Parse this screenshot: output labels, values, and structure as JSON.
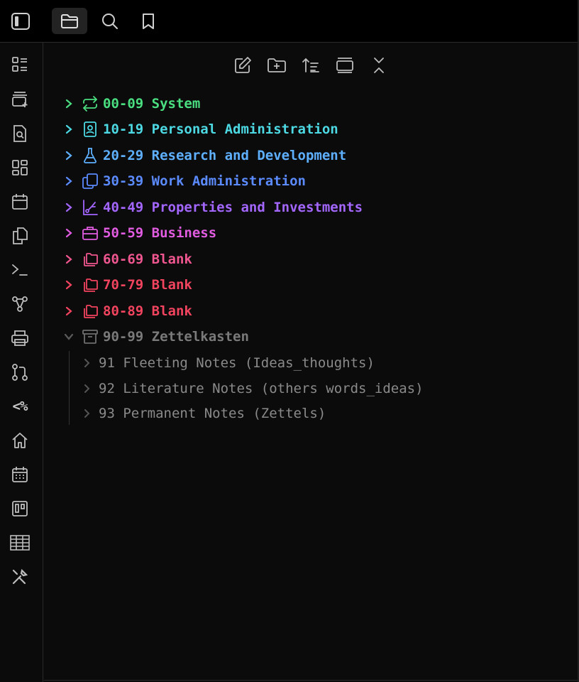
{
  "titlebar": {
    "buttons": [
      {
        "name": "toggle-sidebar-button",
        "icon": "sidebar-panel-icon"
      },
      {
        "name": "file-explorer-tab",
        "icon": "folder-open-icon",
        "active": true
      },
      {
        "name": "search-tab",
        "icon": "search-icon"
      },
      {
        "name": "bookmarks-tab",
        "icon": "bookmark-icon"
      }
    ]
  },
  "ribbon": {
    "items": [
      {
        "icon": "dashboard-list-icon"
      },
      {
        "icon": "new-canvas-icon"
      },
      {
        "icon": "file-search-icon"
      },
      {
        "icon": "layout-grid-icon"
      },
      {
        "icon": "calendar-icon"
      },
      {
        "icon": "copy-files-icon"
      },
      {
        "icon": "terminal-icon"
      },
      {
        "icon": "graph-view-icon"
      },
      {
        "icon": "print-icon"
      },
      {
        "icon": "git-pull-request-icon"
      },
      {
        "icon": "templater-icon",
        "text": "<%"
      },
      {
        "icon": "home-icon"
      },
      {
        "icon": "calendar-days-icon"
      },
      {
        "icon": "kanban-icon"
      },
      {
        "icon": "table-icon"
      },
      {
        "icon": "tools-icon"
      }
    ]
  },
  "explorer_actions": [
    {
      "name": "new-note-button",
      "icon": "edit-icon"
    },
    {
      "name": "new-folder-button",
      "icon": "folder-plus-icon"
    },
    {
      "name": "sort-button",
      "icon": "sort-icon"
    },
    {
      "name": "auto-reveal-button",
      "icon": "reveal-icon"
    },
    {
      "name": "collapse-all-button",
      "icon": "collapse-icon"
    }
  ],
  "folders": [
    {
      "title": "00-09 System",
      "color": "#4ade80",
      "icon": "repeat-icon",
      "expanded": false
    },
    {
      "title": "10-19 Personal Administration",
      "color": "#4dd9e3",
      "icon": "contact-icon",
      "expanded": false
    },
    {
      "title": "20-29 Research and Development",
      "color": "#5eb0ff",
      "icon": "flask-icon",
      "expanded": false
    },
    {
      "title": "30-39 Work Administration",
      "color": "#5b8bff",
      "icon": "copy-icon",
      "expanded": false
    },
    {
      "title": "40-49 Properties and Investments",
      "color": "#a366ff",
      "icon": "chart-icon",
      "expanded": false
    },
    {
      "title": "50-59 Business",
      "color": "#e15ce0",
      "icon": "briefcase-icon",
      "expanded": false
    },
    {
      "title": "60-69 Blank",
      "color": "#f0568f",
      "icon": "folders-icon",
      "expanded": false
    },
    {
      "title": "70-79 Blank",
      "color": "#f2445f",
      "icon": "folders-icon",
      "expanded": false
    },
    {
      "title": "80-89 Blank",
      "color": "#f2445f",
      "icon": "folders-icon",
      "expanded": false
    },
    {
      "title": "90-99 Zettelkasten",
      "color": "#7a7a7a",
      "icon": "archive-icon",
      "expanded": true
    }
  ],
  "subfolders": [
    {
      "title": "91 Fleeting Notes (Ideas_thoughts)"
    },
    {
      "title": "92 Literature Notes (others words_ideas)"
    },
    {
      "title": "93 Permanent Notes (Zettels)"
    }
  ]
}
